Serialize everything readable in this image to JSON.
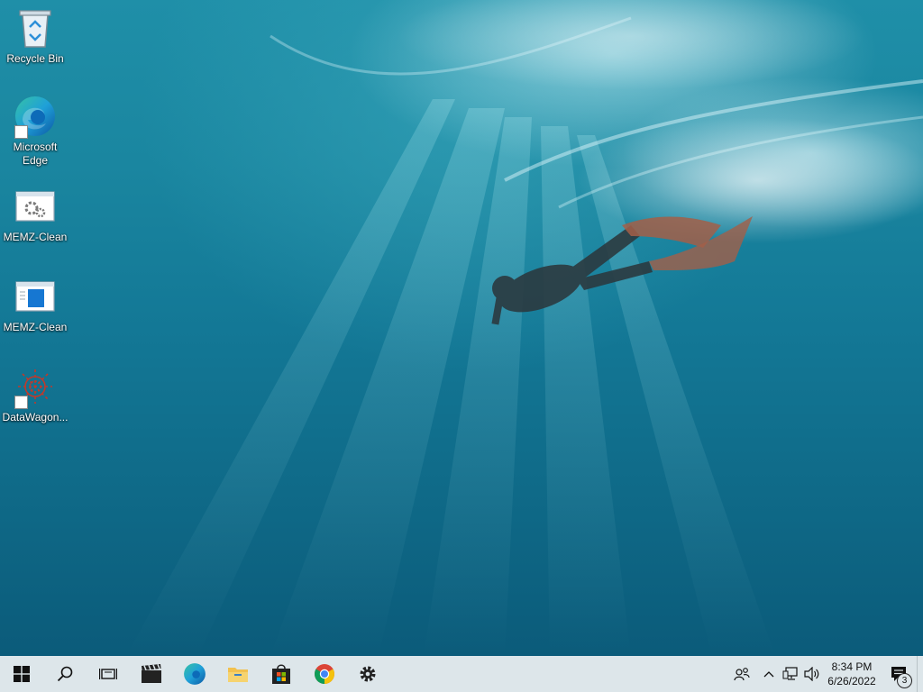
{
  "desktop": {
    "icons": [
      {
        "label": "Recycle Bin",
        "icon": "recycle-bin-icon",
        "shortcut": false
      },
      {
        "label": "Microsoft Edge",
        "icon": "edge-icon",
        "shortcut": true
      },
      {
        "label": "MEMZ-Clean",
        "icon": "gear-window-icon",
        "shortcut": false
      },
      {
        "label": "MEMZ-Clean",
        "icon": "blue-window-icon",
        "shortcut": false
      },
      {
        "label": "DataWagon...",
        "icon": "datawagon-icon",
        "shortcut": true
      }
    ]
  },
  "taskbar": {
    "buttons": [
      {
        "name": "start",
        "icon": "windows-logo-icon"
      },
      {
        "name": "search",
        "icon": "search-icon"
      },
      {
        "name": "task-view",
        "icon": "task-view-icon"
      },
      {
        "name": "video-editor",
        "icon": "clapperboard-icon"
      },
      {
        "name": "edge",
        "icon": "edge-icon"
      },
      {
        "name": "file-explorer",
        "icon": "folder-icon"
      },
      {
        "name": "store",
        "icon": "store-bag-icon"
      },
      {
        "name": "chrome",
        "icon": "chrome-icon"
      },
      {
        "name": "settings",
        "icon": "gear-icon"
      }
    ],
    "tray": {
      "icons": [
        "people-icon",
        "chevron-up-icon",
        "network-icon",
        "volume-icon"
      ],
      "time": "8:34 PM",
      "date": "6/26/2022",
      "notification_count": "3"
    }
  },
  "colors": {
    "taskbar_bg": "#dde6ea",
    "water_top": "#1f8fa8",
    "water_bottom": "#0b5b7a"
  }
}
